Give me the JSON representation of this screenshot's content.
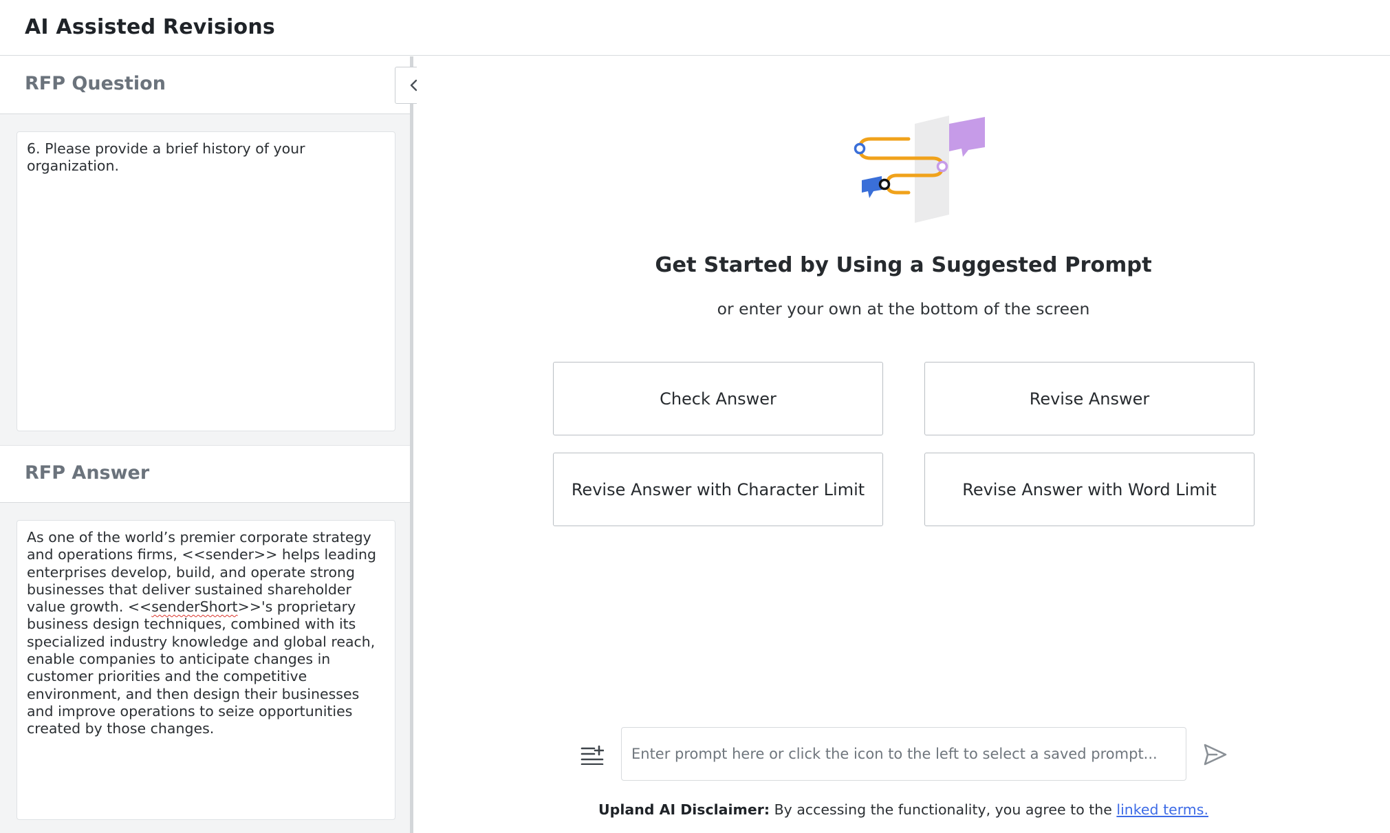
{
  "app": {
    "title": "AI Assisted Revisions"
  },
  "sidebar": {
    "question_title": "RFP Question",
    "question_text": "6. Please provide a brief history of your organization.",
    "answer_title": "RFP Answer",
    "answer_part1": "As one of the world’s premier corporate strategy and operations firms, <<sender>> helps leading enterprises develop, build, and operate strong businesses that deliver sustained shareholder value growth. <<",
    "answer_misspelled": "senderShort",
    "answer_part2": ">>'s proprietary business design techniques, combined with its specialized industry knowledge and global reach, enable companies to anticipate changes in customer priorities and the competitive environment, and then design their businesses and improve operations to seize opportunities created by those changes.",
    "collapse_icon": "chevron-left-icon"
  },
  "main": {
    "headline": "Get Started by Using a Suggested Prompt",
    "subline": "or enter your own at the bottom of the screen",
    "prompts": [
      {
        "label": "Check Answer"
      },
      {
        "label": "Revise Answer"
      },
      {
        "label": "Revise Answer with Character Limit"
      },
      {
        "label": "Revise Answer with Word Limit"
      }
    ],
    "input": {
      "placeholder": "Enter prompt here or click the icon to the left to select a saved prompt...",
      "value": ""
    },
    "saved_prompt_icon": "playlist-add-icon",
    "send_icon": "send-icon",
    "disclaimer": {
      "label": "Upland AI Disclaimer:",
      "text": " By accessing the functionality, you agree to the ",
      "link": "linked terms."
    }
  },
  "colors": {
    "accent_orange": "#f0a21b",
    "accent_purple": "#c69be8",
    "accent_blue": "#3a6fd8",
    "link": "#3d6be6"
  }
}
